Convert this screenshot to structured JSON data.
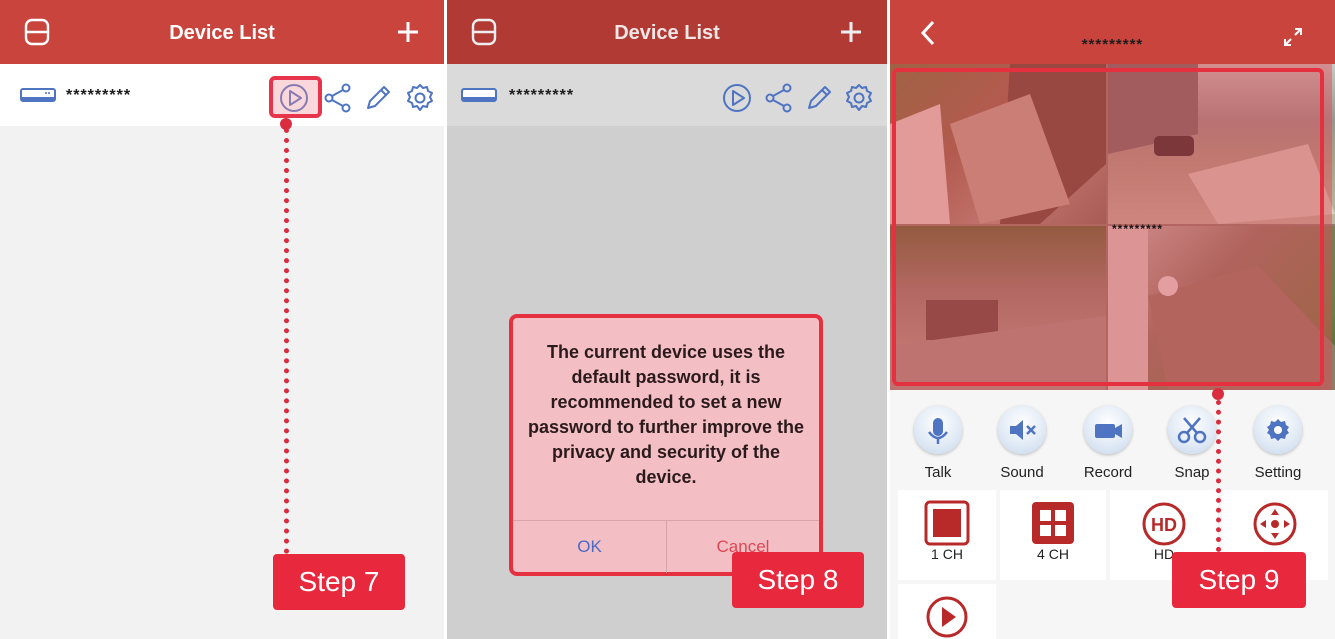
{
  "panels": [
    {
      "header": {
        "title": "Device List"
      },
      "device": {
        "name": "*********"
      },
      "step": "Step 7"
    },
    {
      "header": {
        "title": "Device List"
      },
      "device": {
        "name": "*********"
      },
      "dialog": {
        "message": "The current device uses the default password, it is recommended to set a new password to further improve the privacy and security of the device.",
        "ok_label": "OK",
        "cancel_label": "Cancel"
      },
      "step": "Step 8"
    },
    {
      "header": {
        "title": "*********"
      },
      "video": {
        "overlay_text": "*********"
      },
      "controls": [
        {
          "label": "Talk",
          "icon": "microphone-icon"
        },
        {
          "label": "Sound",
          "icon": "speaker-mute-icon"
        },
        {
          "label": "Record",
          "icon": "video-camera-icon"
        },
        {
          "label": "Snap",
          "icon": "scissors-icon"
        },
        {
          "label": "Setting",
          "icon": "gear-icon"
        }
      ],
      "views": [
        {
          "label": "1 CH",
          "icon": "single-channel-icon"
        },
        {
          "label": "4 CH",
          "icon": "four-channel-icon"
        },
        {
          "label": "HD",
          "icon": "hd-icon"
        },
        {
          "label": "",
          "icon": "ptz-arrows-icon"
        },
        {
          "label": "",
          "icon": "playback-icon"
        }
      ],
      "step": "Step 9"
    }
  ],
  "colors": {
    "header": "#c9443d",
    "highlight": "#e5303f",
    "step_badge": "#e8283d",
    "icon_blue": "#4f74c2"
  }
}
